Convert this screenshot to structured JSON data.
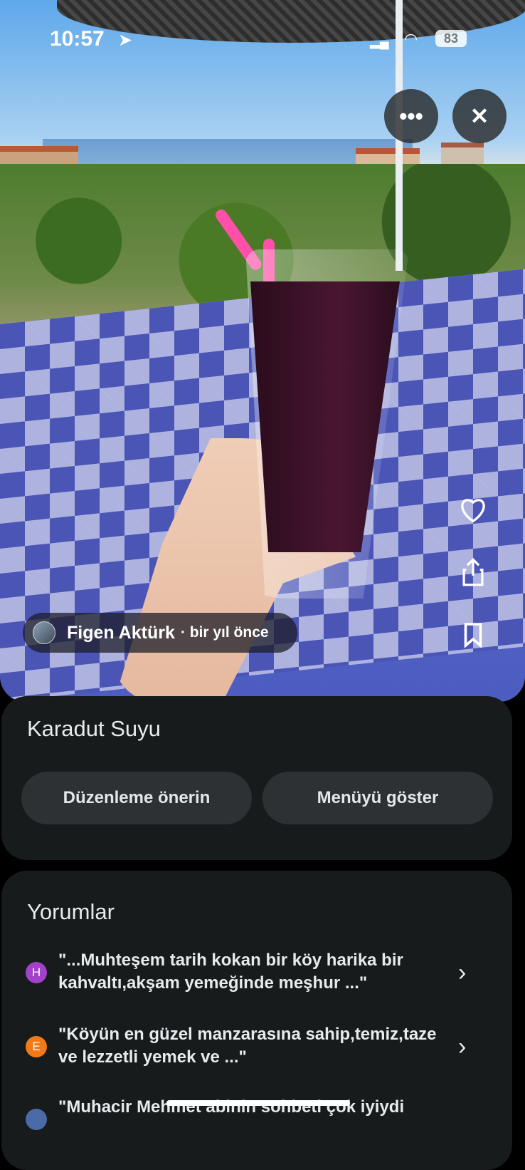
{
  "status_bar": {
    "time": "10:57",
    "battery": "83"
  },
  "photo": {
    "author_name": "Figen Aktürk",
    "author_time": "· bir yıl önce",
    "more_icon": "more-horizontal-icon",
    "close_icon": "close-icon",
    "heart_icon": "heart-icon",
    "share_icon": "share-icon",
    "bookmark_icon": "bookmark-icon"
  },
  "place": {
    "title": "Karadut Suyu",
    "suggest_edit_label": "Düzenleme önerin",
    "show_menu_label": "Menüyü göster"
  },
  "reviews": {
    "title": "Yorumlar",
    "items": [
      {
        "initial": "H",
        "color": "#a142c8",
        "text": "\"...Muhteşem tarih kokan bir köy harika bir kahvaltı,akşam yemeğinde meşhur ...\""
      },
      {
        "initial": "E",
        "color": "#f07a1a",
        "text": "\"Köyün en güzel manzarasına sahip,temiz,taze ve lezzetli yemek ve ...\""
      },
      {
        "initial": "",
        "color": "#4a6aa8",
        "text": "\"Muhacir Mehmet abinin sohbeti çok iyiydi"
      }
    ]
  },
  "colors": {
    "card_bg": "#171b1c",
    "button_bg": "#2d3133",
    "background": "#000000"
  }
}
